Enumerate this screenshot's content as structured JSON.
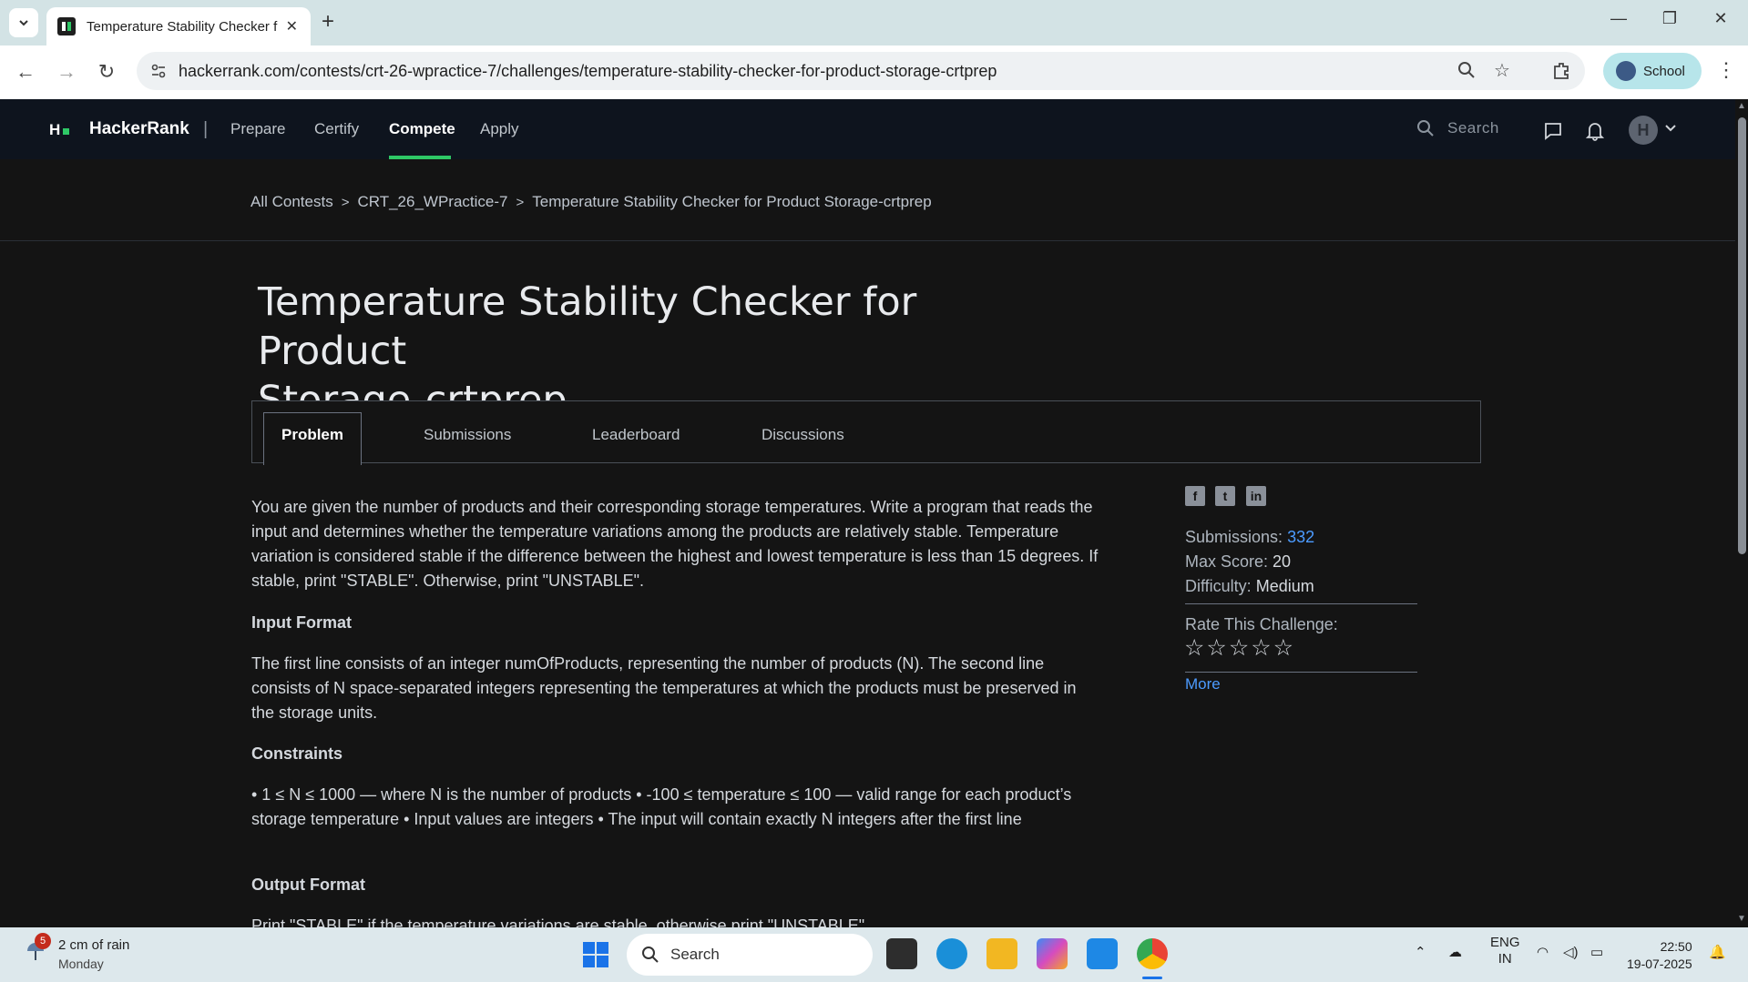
{
  "browser": {
    "tab_title": "Temperature Stability Checker f",
    "url": "hackerrank.com/contests/crt-26-wpractice-7/challenges/temperature-stability-checker-for-product-storage-crtprep",
    "profile_label": "School"
  },
  "header": {
    "brand": "HackerRank",
    "nav": [
      "Prepare",
      "Certify",
      "Compete",
      "Apply"
    ],
    "active_nav": "Compete",
    "search_placeholder": "Search",
    "avatar_letter": "H"
  },
  "breadcrumb": [
    "All Contests",
    "CRT_26_WPractice-7",
    "Temperature Stability Checker for Product Storage-crtprep"
  ],
  "challenge": {
    "title_line1": "Temperature Stability Checker for Product",
    "title_line2": "Storage-crtprep",
    "tabs": [
      "Problem",
      "Submissions",
      "Leaderboard",
      "Discussions"
    ],
    "description": "You are given the number of products and their corresponding storage temperatures. Write a program that reads the input and determines whether the temperature variations among the products are relatively stable. Temperature variation is considered stable if the difference between the highest and lowest temperature is less than 15 degrees. If stable, print \"STABLE\". Otherwise, print \"UNSTABLE\".",
    "input_format_heading": "Input Format",
    "input_format": "The first line consists of an integer numOfProducts, representing the number of products (N). The second line consists of N space-separated integers representing the temperatures at which the products must be preserved in the storage units.",
    "constraints_heading": "Constraints",
    "constraints": "• 1 ≤ N ≤ 1000 — where N is the number of products • -100 ≤ temperature ≤ 100 — valid range for each product’s storage temperature • Input values are integers • The input will contain exactly N integers after the first line",
    "output_format_heading": "Output Format",
    "output_format": "Print \"STABLE\" if the temperature variations are stable, otherwise print \"UNSTABLE\"."
  },
  "sidebar": {
    "submissions_label": "Submissions:",
    "submissions_value": "332",
    "max_score_label": "Max Score:",
    "max_score_value": "20",
    "difficulty_label": "Difficulty:",
    "difficulty_value": "Medium",
    "rate_label": "Rate This Challenge:",
    "stars": "☆☆☆☆☆",
    "more": "More",
    "social_icons": [
      "facebook-icon",
      "twitter-icon",
      "linkedin-icon"
    ]
  },
  "taskbar": {
    "weather_text": "2 cm of rain",
    "weather_day": "Monday",
    "weather_badge": "5",
    "search_label": "Search",
    "lang_top": "ENG",
    "lang_bottom": "IN",
    "time": "22:50",
    "date": "19-07-2025"
  },
  "colors": {
    "accent_green": "#2ec866",
    "link_blue": "#4c9bff",
    "header_bg": "#0e141e",
    "page_bg": "#141414"
  }
}
